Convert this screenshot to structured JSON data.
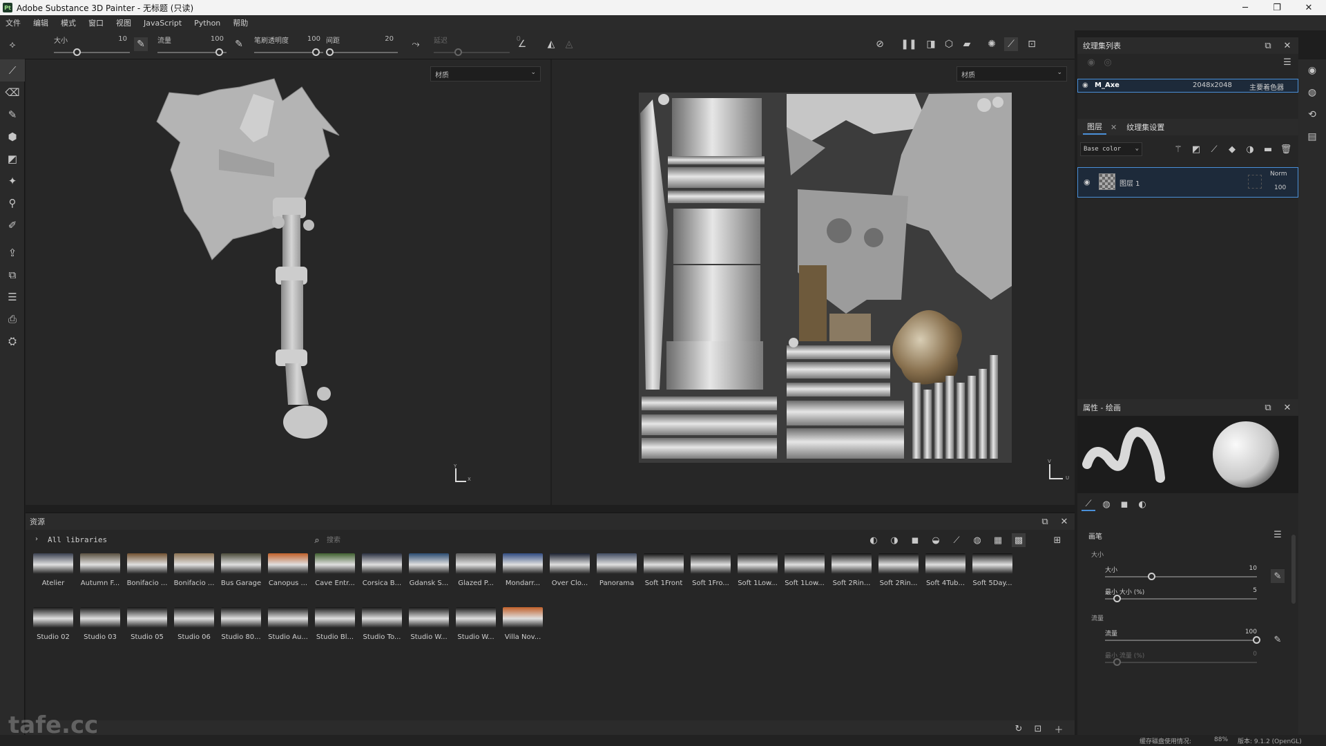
{
  "window": {
    "title": "Adobe Substance 3D Painter - 无标题 (只读)",
    "logo": "Pt"
  },
  "menu": [
    "文件",
    "编辑",
    "模式",
    "窗口",
    "视图",
    "JavaScript",
    "Python",
    "帮助"
  ],
  "toolbar": {
    "size_label": "大小",
    "size_value": "10",
    "flow_label": "流量",
    "flow_value": "100",
    "stroke_opacity_label": "笔刷透明度",
    "stroke_opacity_value": "100",
    "spacing_label": "间距",
    "spacing_value": "20",
    "lazy_label": "延迟",
    "lazy_value": "0"
  },
  "viewport3d": {
    "material_select": "材质",
    "axis_y": "Y",
    "axis_x": "X"
  },
  "viewport2d": {
    "material_select": "材质",
    "axis_v": "V",
    "axis_u": "U"
  },
  "assets": {
    "title": "资源",
    "library": "All libraries",
    "search_placeholder": "搜索",
    "row1": [
      "Atelier",
      "Autumn F...",
      "Bonifacio ...",
      "Bonifacio ...",
      "Bus Garage",
      "Canopus ...",
      "Cave Entr...",
      "Corsica B...",
      "Gdansk S...",
      "Glazed P...",
      "Mondarr...",
      "Over Clo...",
      "Panorama",
      "Soft 1Front",
      "Soft 1Fro...",
      "Soft 1Low...",
      "Soft 1Low...",
      "Soft 2Rin...",
      "Soft 2Rin...",
      "Soft 4Tub...",
      "Soft 5Day..."
    ],
    "row2": [
      "Studio 02",
      "Studio 03",
      "Studio 05",
      "Studio 06",
      "Studio 80...",
      "Studio Au...",
      "Studio Bl...",
      "Studio To...",
      "Studio W...",
      "Studio W...",
      "Villa Nov..."
    ]
  },
  "texture_set_list": {
    "title": "纹理集列表",
    "item_name": "M_Axe",
    "item_resolution": "2048x2048",
    "item_shader": "主要着色器"
  },
  "layers": {
    "tab_layers": "图层",
    "tab_settings": "纹理集设置",
    "channel": "Base color",
    "layer_name": "图层 1",
    "blend_mode": "Norm",
    "opacity": "100"
  },
  "properties": {
    "title": "属性 - 绘画",
    "brush_section": "画笔",
    "size_group": "大小",
    "size_label": "大小",
    "size_value": "10",
    "min_size_label": "最小 大小 (%)",
    "min_size_value": "5",
    "flow_group": "流量",
    "flow_label": "流量",
    "flow_value": "100",
    "min_flow_label": "最小 流量 (%)",
    "min_flow_value": "0"
  },
  "status": {
    "cache": "缓存磁盘使用情况:",
    "cache_value": "88%",
    "version": "版本: 9.1.2 (OpenGL)"
  },
  "watermark": "tafe.cc",
  "colors": {
    "accent": "#4a90d9",
    "bg": "#1e1e1e",
    "panel": "#262626"
  }
}
